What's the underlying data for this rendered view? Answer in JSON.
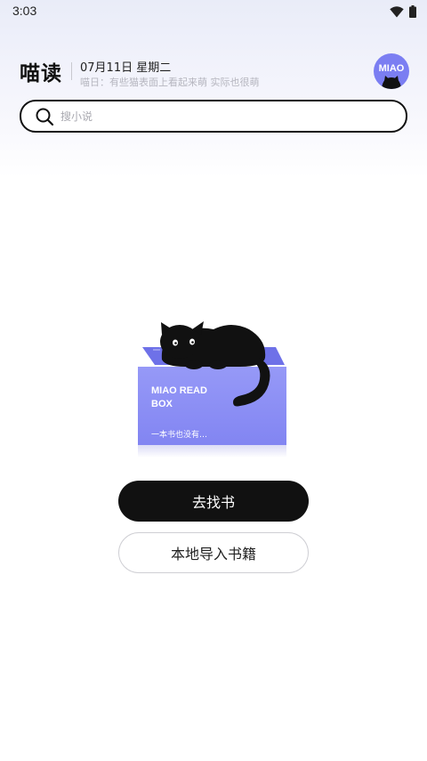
{
  "status_bar": {
    "time": "3:03",
    "icons": [
      "wifi-icon",
      "battery-icon"
    ]
  },
  "header": {
    "app_name": "喵读",
    "date": "07月11日 星期二",
    "slogan": "喵日：有些猫表面上看起来萌 实际也很萌",
    "avatar_text": "MIAO"
  },
  "search": {
    "placeholder": "搜小说",
    "value": ""
  },
  "empty_state": {
    "box_title": "MIAO READ\nBOX",
    "box_subtitle": "一本书也没有…"
  },
  "actions": {
    "find_books_label": "去找书",
    "import_local_label": "本地导入书籍"
  },
  "colors": {
    "accent": "#7b7ef2",
    "box_purple": "#8b8ef5",
    "primary_button": "#111111"
  }
}
